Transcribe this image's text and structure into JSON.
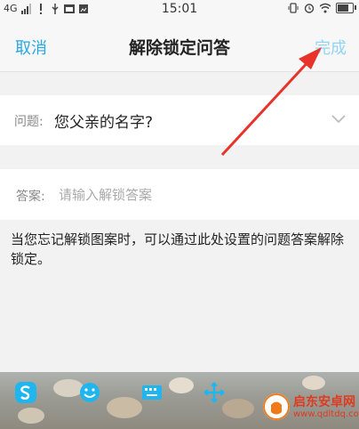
{
  "status_bar": {
    "network": "4G",
    "time": "15:01"
  },
  "nav": {
    "cancel_label": "取消",
    "title": "解除锁定问答",
    "done_label": "完成"
  },
  "question": {
    "label": "问题:",
    "value": "您父亲的名字?"
  },
  "answer": {
    "label": "答案:",
    "placeholder": "请输入解锁答案"
  },
  "hint_text": "当您忘记解锁图案时，可以通过此处设置的问题答案解除锁定。",
  "keyboard_icons": [
    "s-keyboard-icon",
    "emoji-icon",
    "keyboard-icon",
    "cursor-move-icon"
  ],
  "colors": {
    "accent": "#27a9e6",
    "done_disabled": "#94d4f3",
    "arrow": "#e8332a"
  },
  "watermark": {
    "title": "启东安卓网",
    "url": "www.qdltdq.com"
  }
}
